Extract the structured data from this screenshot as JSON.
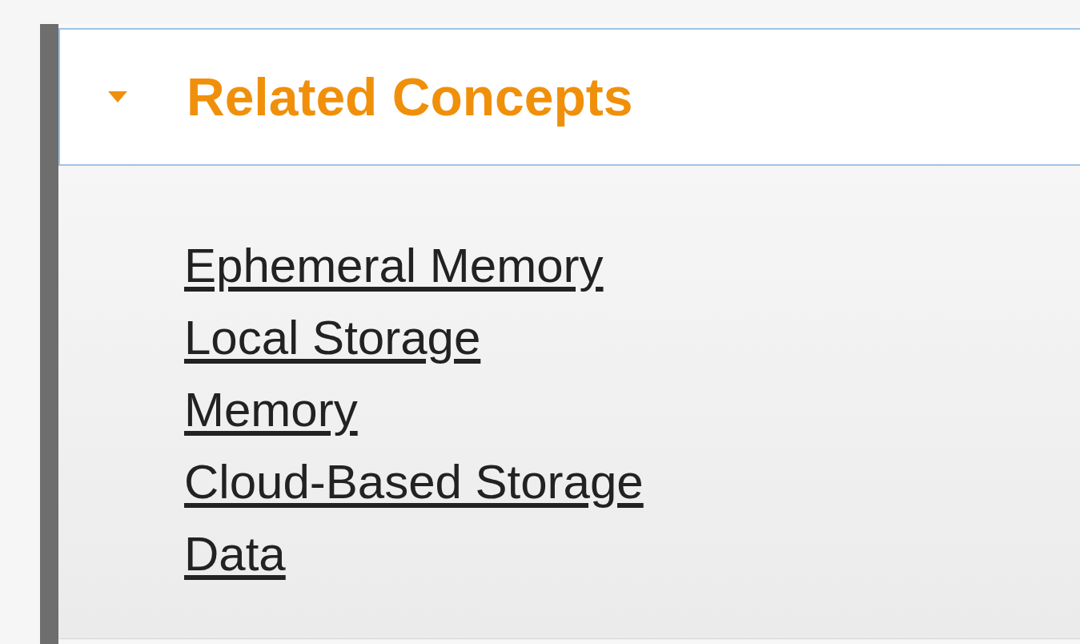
{
  "section": {
    "title": "Related Concepts",
    "expanded": true,
    "links": [
      "Ephemeral Memory",
      "Local Storage",
      "Memory",
      "Cloud-Based Storage",
      "Data"
    ]
  }
}
